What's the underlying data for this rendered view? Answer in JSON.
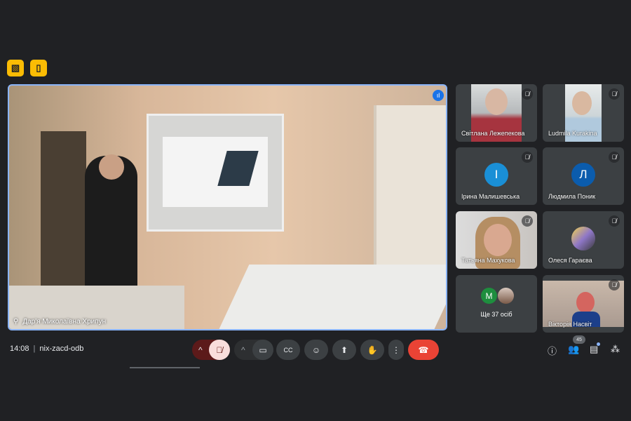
{
  "top_buttons": [
    {
      "icon": "no-video-icon"
    },
    {
      "icon": "door-exit-icon"
    }
  ],
  "main_video": {
    "speaker_name": "Дар'я Миколаївна Хрипун"
  },
  "participants": [
    {
      "name": "Світлана Лежепекова",
      "muted": true,
      "video": true
    },
    {
      "name": "Ludmila Kurakina",
      "muted": true,
      "video": true
    },
    {
      "name": "Ірина Малишевська",
      "muted": true,
      "initial": "І",
      "color": "#1a8fd6"
    },
    {
      "name": "Людмила Поник",
      "muted": true,
      "initial": "Л",
      "color": "#0b5cad"
    },
    {
      "name": "Татьяна Махукова",
      "muted": true,
      "video": true
    },
    {
      "name": "Олеся Гараєва",
      "muted": true,
      "avatar": true
    },
    {
      "name": "Ще 37 осіб",
      "initial": "M",
      "color": "#1e8e3e"
    },
    {
      "name": "Вікторія Насвіт",
      "muted": true,
      "video": true
    }
  ],
  "bottom": {
    "time": "14:08",
    "separator": "|",
    "meeting_code": "nix-zacd-odb",
    "people_count": "45"
  },
  "colors": {
    "accent": "#8ab4f8",
    "end_call": "#ea4335",
    "mic_off": "#f9dedc"
  }
}
